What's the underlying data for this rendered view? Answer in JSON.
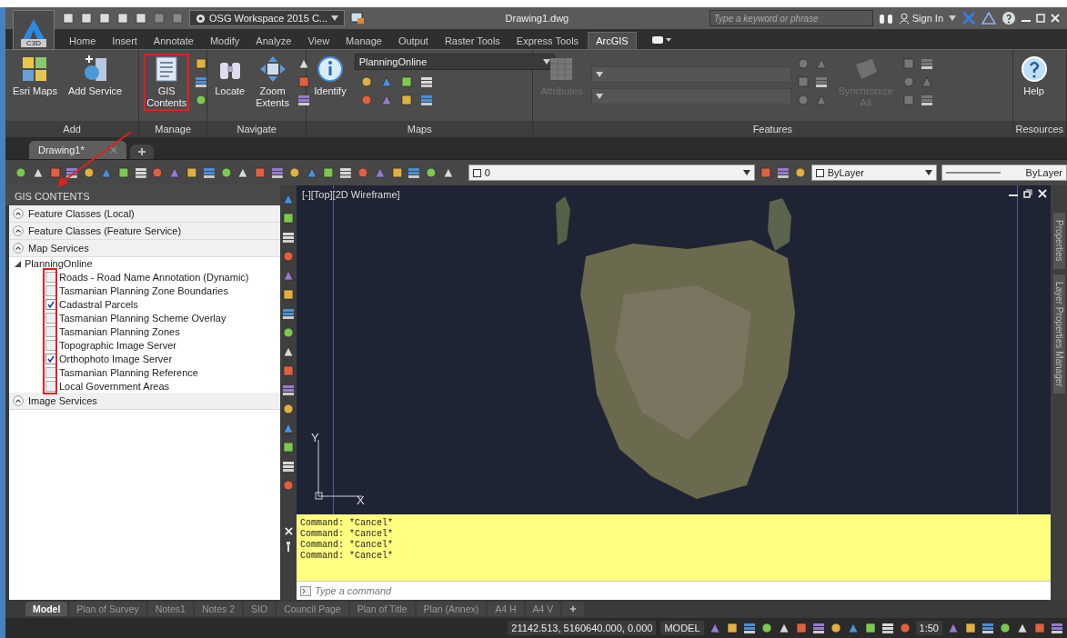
{
  "title_bar": {
    "app_badge": "C3D",
    "workspace": "OSG Workspace 2015 C...",
    "document_title": "Drawing1.dwg",
    "search": {
      "placeholder": "Type a keyword or phrase"
    },
    "sign_in": "Sign In"
  },
  "ribbon_tabs": [
    {
      "label": "Home",
      "selected": false
    },
    {
      "label": "Insert",
      "selected": false
    },
    {
      "label": "Annotate",
      "selected": false
    },
    {
      "label": "Modify",
      "selected": false
    },
    {
      "label": "Analyze",
      "selected": false
    },
    {
      "label": "View",
      "selected": false
    },
    {
      "label": "Manage",
      "selected": false
    },
    {
      "label": "Output",
      "selected": false
    },
    {
      "label": "Raster Tools",
      "selected": false
    },
    {
      "label": "Express Tools",
      "selected": false
    },
    {
      "label": "ArcGIS",
      "selected": true
    }
  ],
  "ribbon_panels": [
    {
      "title": "Add",
      "items": [
        {
          "kind": "large",
          "label": "Esri Maps",
          "disabled": false,
          "highlighted": false
        },
        {
          "kind": "large",
          "label": "Add Service",
          "disabled": false,
          "highlighted": false
        }
      ]
    },
    {
      "title": "Manage",
      "items": [
        {
          "kind": "large",
          "label": "GIS Contents",
          "disabled": false,
          "highlighted": true
        },
        {
          "kind": "icons",
          "disabled": false
        }
      ]
    },
    {
      "title": "Navigate",
      "items": [
        {
          "kind": "large",
          "label": "Locate",
          "disabled": false,
          "highlighted": false
        },
        {
          "kind": "large",
          "label": "Zoom Extents",
          "disabled": false,
          "highlighted": false
        },
        {
          "kind": "icons",
          "disabled": false
        }
      ]
    },
    {
      "title": "Maps",
      "items": [
        {
          "kind": "large",
          "label": "Identify",
          "disabled": false,
          "highlighted": false
        },
        {
          "kind": "combo",
          "value": "PlanningOnline"
        }
      ]
    },
    {
      "title": "Features",
      "items": [
        {
          "kind": "large",
          "label": "Attributes",
          "disabled": true,
          "highlighted": false
        },
        {
          "kind": "combo_pair",
          "disabled": true
        },
        {
          "kind": "icons",
          "disabled": true
        },
        {
          "kind": "large",
          "label": "Synchronize All",
          "disabled": true,
          "highlighted": false
        },
        {
          "kind": "icons",
          "disabled": true
        }
      ]
    },
    {
      "title": "Resources",
      "items": [
        {
          "kind": "large",
          "label": "Help",
          "disabled": false,
          "highlighted": false
        }
      ]
    }
  ],
  "document_tabs": [
    {
      "label": "Drawing1*",
      "selected": true
    }
  ],
  "properties_toolbar": {
    "layer": "0",
    "object_props": [
      "ByLayer",
      "ByLayer"
    ]
  },
  "gis_contents": {
    "title": "GIS CONTENTS",
    "sections": [
      {
        "label": "Feature Classes (Local)"
      },
      {
        "label": "Feature Classes (Feature Service)"
      },
      {
        "label": "Map Services",
        "children": [
          {
            "label": "PlanningOnline",
            "expanded": true,
            "highlighted": true,
            "children": [
              {
                "label": "Roads - Road Name Annotation (Dynamic)",
                "checked": false
              },
              {
                "label": "Tasmanian Planning Zone Boundaries",
                "checked": false
              },
              {
                "label": "Cadastral Parcels",
                "checked": true
              },
              {
                "label": "Tasmanian Planning Scheme Overlay",
                "checked": false
              },
              {
                "label": "Tasmanian Planning Zones",
                "checked": false
              },
              {
                "label": "Topographic Image Server",
                "checked": false
              },
              {
                "label": "Orthophoto Image Server",
                "checked": true
              },
              {
                "label": "Tasmanian Planning Reference",
                "checked": false
              },
              {
                "label": "Local Government Areas",
                "checked": false
              }
            ]
          }
        ]
      },
      {
        "label": "Image Services"
      }
    ]
  },
  "viewport": {
    "label": "[-][Top][2D Wireframe]",
    "axis_y": "Y",
    "axis_x": "X"
  },
  "side_palettes": [
    "Properties",
    "Layer Properties Manager"
  ],
  "command_history": [
    "Command: *Cancel*",
    "Command: *Cancel*",
    "Command: *Cancel*",
    "Command: *Cancel*"
  ],
  "command_input": {
    "placeholder": "Type a command"
  },
  "layout_tabs": [
    {
      "label": "Model",
      "selected": true
    },
    {
      "label": "Plan of Survey",
      "selected": false
    },
    {
      "label": "Notes1",
      "selected": false
    },
    {
      "label": "Notes 2",
      "selected": false
    },
    {
      "label": "SIO",
      "selected": false
    },
    {
      "label": "Council Page",
      "selected": false
    },
    {
      "label": "Plan of Title",
      "selected": false
    },
    {
      "label": "Plan (Annex)",
      "selected": false
    },
    {
      "label": "A4 H",
      "selected": false
    },
    {
      "label": "A4 V",
      "selected": false
    }
  ],
  "status_bar": {
    "coordinates": "21142.513, 5160640.000, 0.000",
    "space": "MODEL",
    "scale": "1:50"
  }
}
